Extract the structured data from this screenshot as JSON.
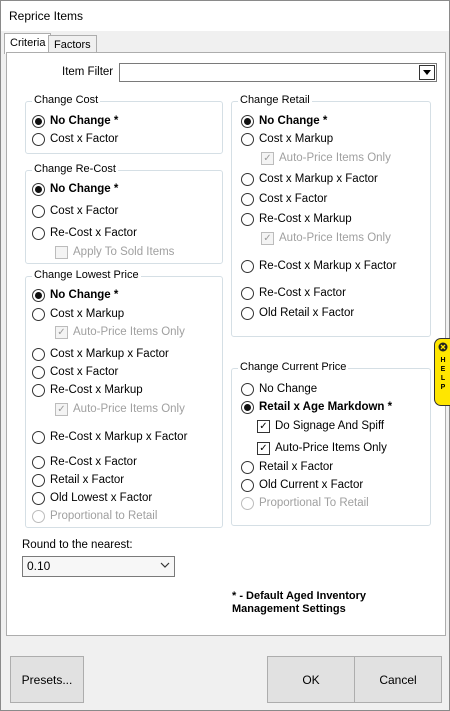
{
  "window": {
    "title": "Reprice Items"
  },
  "tabs": [
    {
      "label": "Criteria"
    },
    {
      "label": "Factors"
    }
  ],
  "item_filter": {
    "label": "Item Filter",
    "value": ""
  },
  "change_cost": {
    "title": "Change Cost",
    "options": [
      "No Change *",
      "Cost x Factor"
    ]
  },
  "change_recost": {
    "title": "Change Re-Cost",
    "options": [
      "No Change *",
      "Cost x Factor",
      "Re-Cost x Factor"
    ],
    "apply_sold": "Apply To Sold Items"
  },
  "change_lowest": {
    "title": "Change Lowest Price",
    "options": [
      "No Change *",
      "Cost x Markup",
      "Cost x Markup x Factor",
      "Cost x Factor",
      "Re-Cost x Markup",
      "Re-Cost x Markup x Factor",
      "Re-Cost x Factor",
      "Retail x Factor",
      "Old Lowest x Factor",
      "Proportional to Retail"
    ],
    "auto_price_1": "Auto-Price Items Only",
    "auto_price_2": "Auto-Price Items Only"
  },
  "change_retail": {
    "title": "Change Retail",
    "options": [
      "No Change *",
      "Cost x Markup",
      "Cost x Markup x Factor",
      "Cost x Factor",
      "Re-Cost x Markup",
      "Re-Cost x Markup x Factor",
      "Re-Cost x Factor",
      "Old Retail x Factor"
    ],
    "auto_price_1": "Auto-Price Items Only",
    "auto_price_2": "Auto-Price Items Only"
  },
  "change_current": {
    "title": "Change Current Price",
    "options": [
      "No Change",
      "Retail x Age Markdown *",
      "Retail x Factor",
      "Old Current x Factor",
      "Proportional To Retail"
    ],
    "do_signage": "Do Signage And Spiff",
    "auto_price": "Auto-Price Items Only"
  },
  "round": {
    "label": "Round to the nearest:",
    "value": "0.10"
  },
  "note": {
    "line1": "* - Default Aged Inventory",
    "line2": "Management Settings"
  },
  "buttons": {
    "presets": "Presets...",
    "ok": "OK",
    "cancel": "Cancel"
  },
  "help_tab": {
    "label": "HELP"
  }
}
